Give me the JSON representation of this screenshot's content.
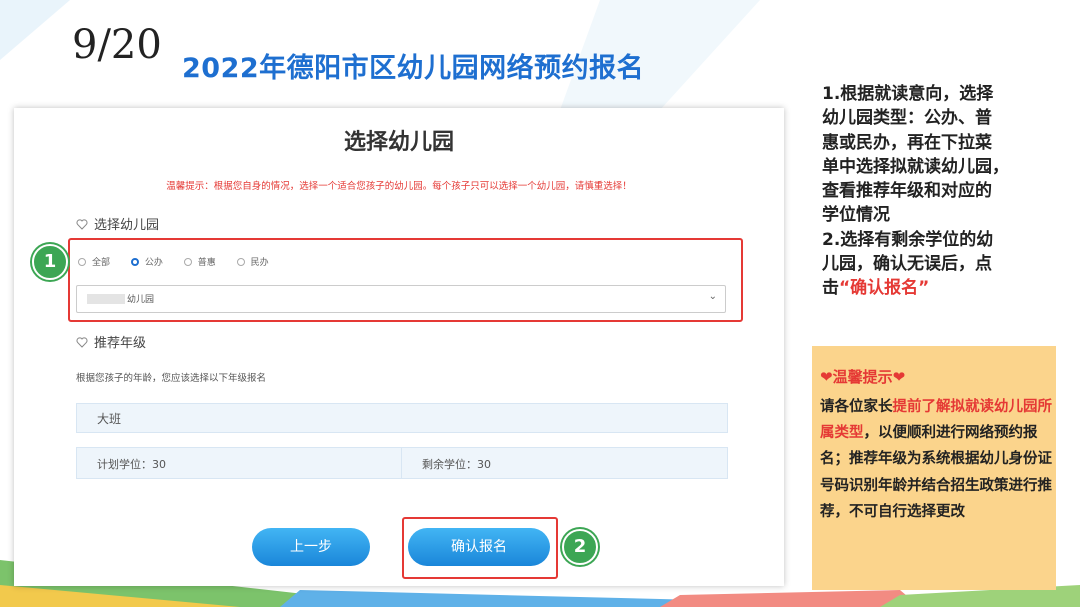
{
  "slide": {
    "page_number": "9/20",
    "title": "2022年德阳市区幼儿园网络预约报名"
  },
  "form": {
    "heading": "选择幼儿园",
    "tip": "温馨提示：根据您自身的情况，选择一个适合您孩子的幼儿园。每个孩子只可以选择一个幼儿园，请慎重选择！",
    "section_kindergarten": "选择幼儿园",
    "radio_options": [
      "全部",
      "公办",
      "普惠",
      "民办"
    ],
    "selected_radio": "公办",
    "select_value": "幼儿园",
    "section_grade": "推荐年级",
    "grade_desc": "根据您孩子的年龄，您应该选择以下年级报名",
    "grade": "大班",
    "planned_seats": "计划学位：30",
    "remaining_seats": "剩余学位：30",
    "prev_button": "上一步",
    "confirm_button": "确认报名"
  },
  "badges": {
    "step1": "1",
    "step2": "2"
  },
  "instructions": {
    "line1": "1.根据就读意向，选择",
    "line2": "幼儿园类型：公办、普",
    "line3": "惠或民办，再在下拉菜",
    "line4": "单中选择拟就读幼儿园，",
    "line5": "查看推荐年级和对应的",
    "line6": "学位情况",
    "line7": "2.选择有剩余学位的幼",
    "line8": "儿园，确认无误后，点",
    "line9_prefix": "击",
    "line9_quoted": "“确认报名”"
  },
  "warm_tip": {
    "title": "❤温馨提示❤",
    "p1": "请各位家长",
    "p2_emph": "提前了解拟就读幼儿园所属类型",
    "p3": "，以便顺利进行网络预约报名；推荐年级为系统根据幼儿身份证号码识别年龄并结合招生政策进行推荐，不可自行选择更改"
  },
  "colors": {
    "accent_blue": "#1e6fd0",
    "highlight_red": "#e53935",
    "badge_green": "#3ca654",
    "note_bg": "#fbd48c"
  }
}
